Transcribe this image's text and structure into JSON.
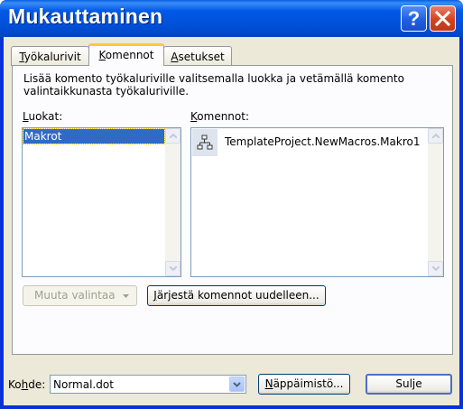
{
  "window": {
    "title": "Mukauttaminen",
    "help_label": "?"
  },
  "tabs": [
    {
      "label": "Työkalurivit",
      "mnemonic": "T",
      "rest": "yökalurivit",
      "active": false
    },
    {
      "label": "Komennot",
      "mnemonic": "K",
      "rest": "omennot",
      "active": true
    },
    {
      "label": "Asetukset",
      "mnemonic": "A",
      "rest": "setukset",
      "active": false
    }
  ],
  "panel": {
    "description": "Lisää komento työkaluriville valitsemalla luokka ja vetämällä komento valintaikkunasta työkaluriville.",
    "categories_label_m": "L",
    "categories_label_rest": "uokat:",
    "categories": [
      "Makrot"
    ],
    "commands_label_m": "K",
    "commands_label_rest": "omennot:",
    "commands": [
      {
        "label": "TemplateProject.NewMacros.Makro1",
        "icon": "macro-icon"
      }
    ],
    "modify_selection_label": "Muuta valintaa",
    "rearrange_prefix": "",
    "rearrange_m": "J",
    "rearrange_rest": "ärjestä komennot uudelleen..."
  },
  "footer": {
    "target_label_pre": "Ko",
    "target_label_m": "h",
    "target_label_post": "de:",
    "target_value": "Normal.dot",
    "keyboard_m": "N",
    "keyboard_rest": "äppäimistö...",
    "close_label": "Sulje"
  },
  "colors": {
    "selection": "#316ac5",
    "titlebar": "#0058e6",
    "active_tab_accent": "#ffc83c"
  }
}
